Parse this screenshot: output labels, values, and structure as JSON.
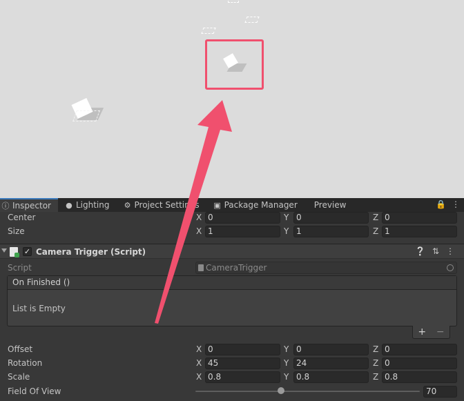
{
  "tabs": [
    {
      "label": "Inspector",
      "icon": "info-icon",
      "active": true
    },
    {
      "label": "Lighting",
      "icon": "bulb-icon",
      "active": false
    },
    {
      "label": "Project Settings",
      "icon": "gear-icon",
      "active": false
    },
    {
      "label": "Package Manager",
      "icon": "package-icon",
      "active": false
    },
    {
      "label": "Preview",
      "icon": "",
      "active": false
    }
  ],
  "collider": {
    "center": {
      "label": "Center",
      "x": "0",
      "y": "0",
      "z": "0"
    },
    "size": {
      "label": "Size",
      "x": "1",
      "y": "1",
      "z": "1"
    }
  },
  "axes": {
    "x": "X",
    "y": "Y",
    "z": "Z"
  },
  "component": {
    "title": "Camera Trigger (Script)",
    "enabled_check": "✓",
    "script_label": "Script",
    "script_value": "CameraTrigger"
  },
  "event": {
    "title": "On Finished ()",
    "empty_text": "List is Empty",
    "add_label": "+",
    "remove_label": "−"
  },
  "transform": {
    "offset": {
      "label": "Offset",
      "x": "0",
      "y": "0",
      "z": "0"
    },
    "rotation": {
      "label": "Rotation",
      "x": "45",
      "y": "24",
      "z": "0"
    },
    "scale": {
      "label": "Scale",
      "x": "0.8",
      "y": "0.8",
      "z": "0.8"
    }
  },
  "fov": {
    "label": "Field Of View",
    "value": "70",
    "fraction": 0.38
  },
  "colors": {
    "scene_bg": "#dcdcdc",
    "highlight": "#f0506e",
    "panel_bg": "#383838",
    "active_tab": "#3a79bb"
  }
}
